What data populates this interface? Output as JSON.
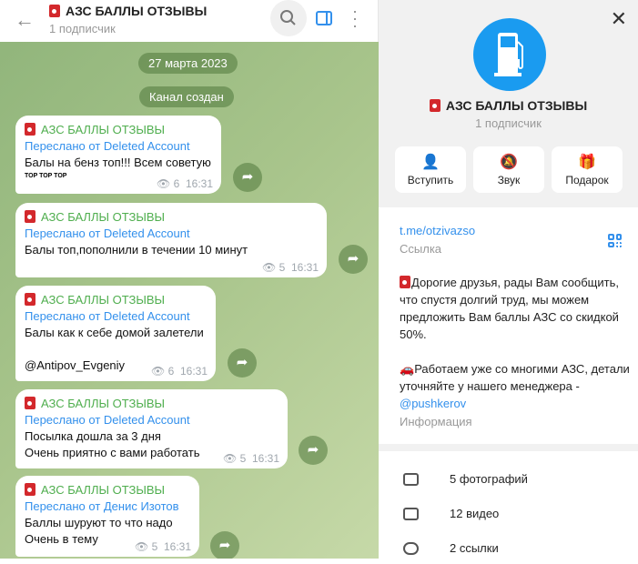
{
  "header": {
    "title": "АЗС БАЛЛЫ ОТЗЫВЫ",
    "subtitle": "1 подписчик"
  },
  "chat": {
    "date": "27 марта 2023",
    "service": "Канал создан",
    "messages": [
      {
        "author": "АЗС БАЛЛЫ ОТЗЫВЫ",
        "forwarded": "Переслано от Deleted Account",
        "lines": [
          "Балы на бенз топ!!! Всем советую"
        ],
        "extra": "TOP TOP TOP",
        "views": "6",
        "time": "16:31"
      },
      {
        "author": "АЗС БАЛЛЫ ОТЗЫВЫ",
        "forwarded": "Переслано от Deleted Account",
        "lines": [
          "Балы топ,пополнили в течении 10 минут"
        ],
        "views": "5",
        "time": "16:31"
      },
      {
        "author": "АЗС БАЛЛЫ ОТЗЫВЫ",
        "forwarded": "Переслано от Deleted Account",
        "lines": [
          "Балы как к себе домой залетели"
        ],
        "mention": "@Antipov_Evgeniy",
        "views": "6",
        "time": "16:31"
      },
      {
        "author": "АЗС БАЛЛЫ ОТЗЫВЫ",
        "forwarded": "Переслано от Deleted Account",
        "lines": [
          "Посылка дошла за 3 дня",
          "Очень приятно с вами работать"
        ],
        "views": "5",
        "time": "16:31"
      },
      {
        "author": "АЗС БАЛЛЫ ОТЗЫВЫ",
        "forwarded": "Переслано от Денис Изотов",
        "lines": [
          "Баллы шуруют то что надо",
          "Очень в тему"
        ],
        "views": "5",
        "time": "16:31"
      }
    ]
  },
  "profile": {
    "title": "АЗС БАЛЛЫ ОТЗЫВЫ",
    "subtitle": "1 подписчик",
    "actions": [
      "Вступить",
      "Звук",
      "Подарок"
    ],
    "link": "t.me/otzivazso",
    "link_label": "Ссылка",
    "desc1": "Дорогие друзья, рады Вам сообщить, что спустя долгий труд, мы можем предложить Вам баллы АЗС со скидкой 50%.",
    "desc2": "Работаем уже со многими АЗС, детали уточняйте у нашего менеджера - ",
    "desc_mention": "@pushkerov",
    "info_label": "Информация",
    "media": [
      "5 фотографий",
      "12 видео",
      "2 ссылки"
    ]
  },
  "colors": {
    "accent": "#3390ec",
    "author": "#4fae4e",
    "avatar": "#1a9bf0"
  }
}
